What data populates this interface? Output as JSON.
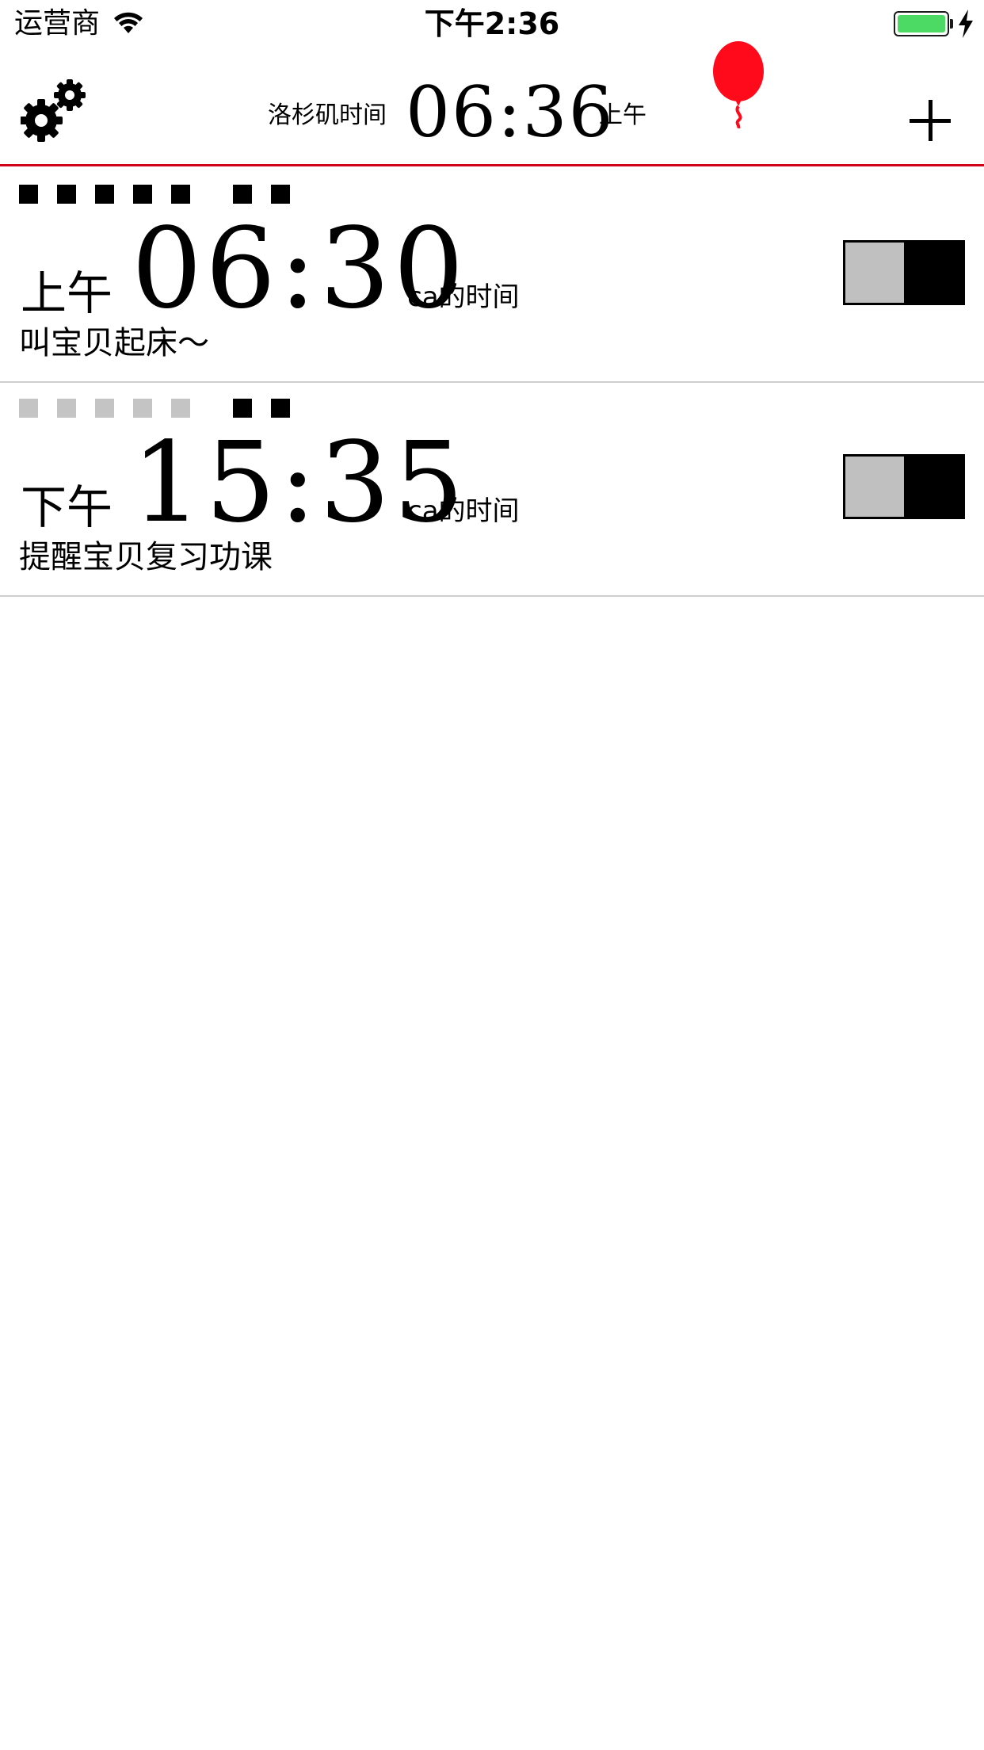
{
  "status_bar": {
    "carrier": "运营商",
    "time": "下午2:36",
    "battery_color": "#4cd964",
    "icons": [
      "wifi-icon",
      "battery-icon",
      "charging-bolt-icon"
    ]
  },
  "header": {
    "city_label": "洛杉矶时间",
    "time": "06:36",
    "ampm": "上午",
    "accent_color": "#d0021b",
    "icons": [
      "settings-gears-icon",
      "balloon-icon",
      "add-icon"
    ]
  },
  "alarms": [
    {
      "days_active": [
        true,
        true,
        true,
        true,
        true,
        true,
        true
      ],
      "ampm": "上午",
      "time": "06:30",
      "timezone_label": "ca的时间",
      "note": "叫宝贝起床～",
      "enabled": true
    },
    {
      "days_active": [
        false,
        false,
        false,
        false,
        false,
        true,
        true
      ],
      "ampm": "下午",
      "time": "15:35",
      "timezone_label": "ca的时间",
      "note": "提醒宝贝复习功课",
      "enabled": true
    }
  ]
}
